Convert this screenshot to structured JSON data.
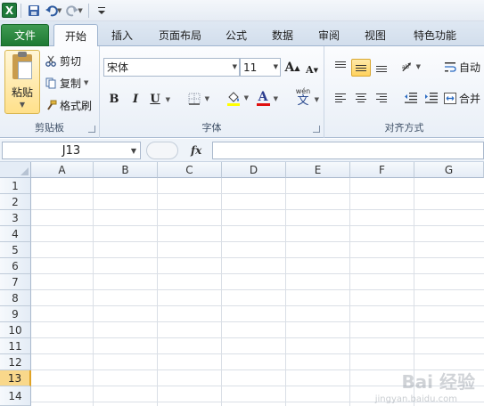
{
  "app": {
    "icon_letter": "X"
  },
  "tabs": [
    "文件",
    "开始",
    "插入",
    "页面布局",
    "公式",
    "数据",
    "审阅",
    "视图",
    "特色功能"
  ],
  "ribbon": {
    "clipboard": {
      "paste": "粘贴",
      "cut": "剪切",
      "copy": "复制",
      "format_painter": "格式刷",
      "label": "剪贴板"
    },
    "font": {
      "name": "宋体",
      "size": "11",
      "bold": "B",
      "italic": "I",
      "underline": "U",
      "grow": "A",
      "shrink": "A",
      "font_color": "A",
      "phonetic": "wén",
      "phonetic_char": "文",
      "label": "字体"
    },
    "alignment": {
      "wrap_label": "自动",
      "merge_label": "合并",
      "label": "对齐方式"
    }
  },
  "formula_bar": {
    "name_box": "J13",
    "fx": "fx",
    "content": ""
  },
  "sheet": {
    "columns": [
      "A",
      "B",
      "C",
      "D",
      "E",
      "F",
      "G"
    ],
    "rows": [
      "1",
      "2",
      "3",
      "4",
      "5",
      "6",
      "7",
      "8",
      "9",
      "10",
      "11",
      "12",
      "13",
      "14"
    ],
    "selected_row": "13"
  },
  "watermark": {
    "text": "Bai 经验",
    "sub": "jingyan.baidu.com"
  },
  "colors": {
    "file_tab": "#1e7a34",
    "selected_row": "#f9d88b",
    "highlight": "#ffd25e"
  }
}
